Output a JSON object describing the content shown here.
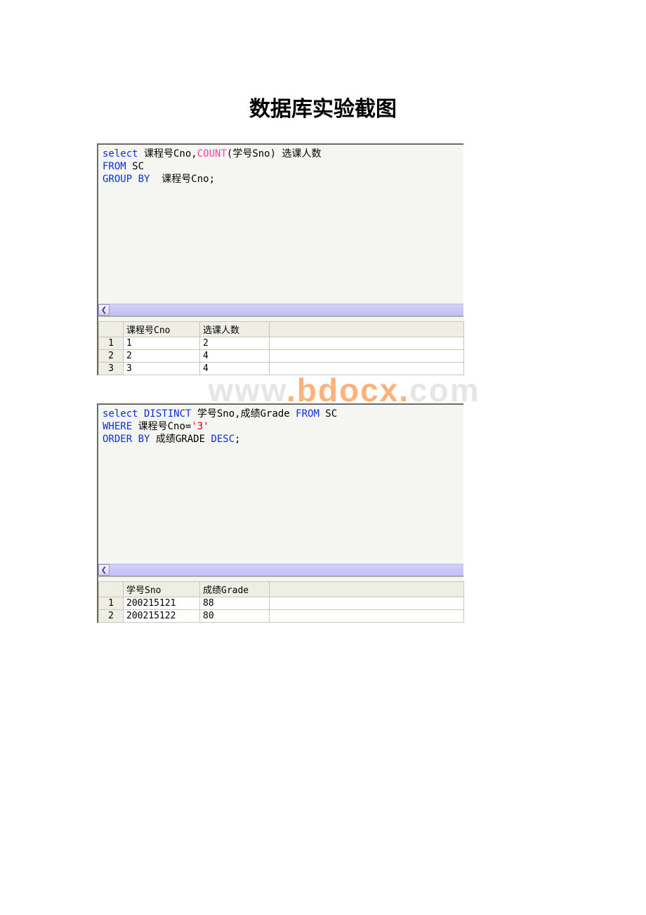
{
  "title": "数据库实验截图",
  "watermark": {
    "pre": "www",
    "mid": ".bdocx.",
    "post": "com"
  },
  "block1": {
    "sql_lines": [
      [
        {
          "cls": "kw-blue",
          "t": "select"
        },
        {
          "cls": "txt",
          "t": " 课程号Cno,"
        },
        {
          "cls": "kw-pink",
          "t": "COUNT"
        },
        {
          "cls": "txt",
          "t": "(学号Sno) 选课人数"
        }
      ],
      [
        {
          "cls": "kw-blue",
          "t": "FROM"
        },
        {
          "cls": "txt",
          "t": " SC"
        }
      ],
      [
        {
          "cls": "kw-blue",
          "t": "GROUP BY"
        },
        {
          "cls": "txt",
          "t": "  课程号Cno;"
        }
      ]
    ],
    "columns": [
      "课程号Cno",
      "选课人数"
    ],
    "rows": [
      [
        "1",
        "2"
      ],
      [
        "2",
        "4"
      ],
      [
        "3",
        "4"
      ]
    ]
  },
  "block2": {
    "sql_lines": [
      [
        {
          "cls": "kw-blue",
          "t": "select DISTINCT"
        },
        {
          "cls": "txt",
          "t": " 学号Sno,成绩Grade "
        },
        {
          "cls": "kw-blue",
          "t": "FROM"
        },
        {
          "cls": "txt",
          "t": " SC"
        }
      ],
      [
        {
          "cls": "kw-blue",
          "t": "WHERE"
        },
        {
          "cls": "txt",
          "t": " 课程号Cno="
        },
        {
          "cls": "kw-red",
          "t": "'3'"
        }
      ],
      [
        {
          "cls": "kw-blue",
          "t": "ORDER BY "
        },
        {
          "cls": "txt",
          "t": "成绩GRADE "
        },
        {
          "cls": "kw-blue",
          "t": "DESC"
        },
        {
          "cls": "txt",
          "t": ";"
        }
      ]
    ],
    "columns": [
      "学号Sno",
      "成绩Grade"
    ],
    "rows": [
      [
        "200215121",
        "88"
      ],
      [
        "200215122",
        "80"
      ]
    ]
  }
}
